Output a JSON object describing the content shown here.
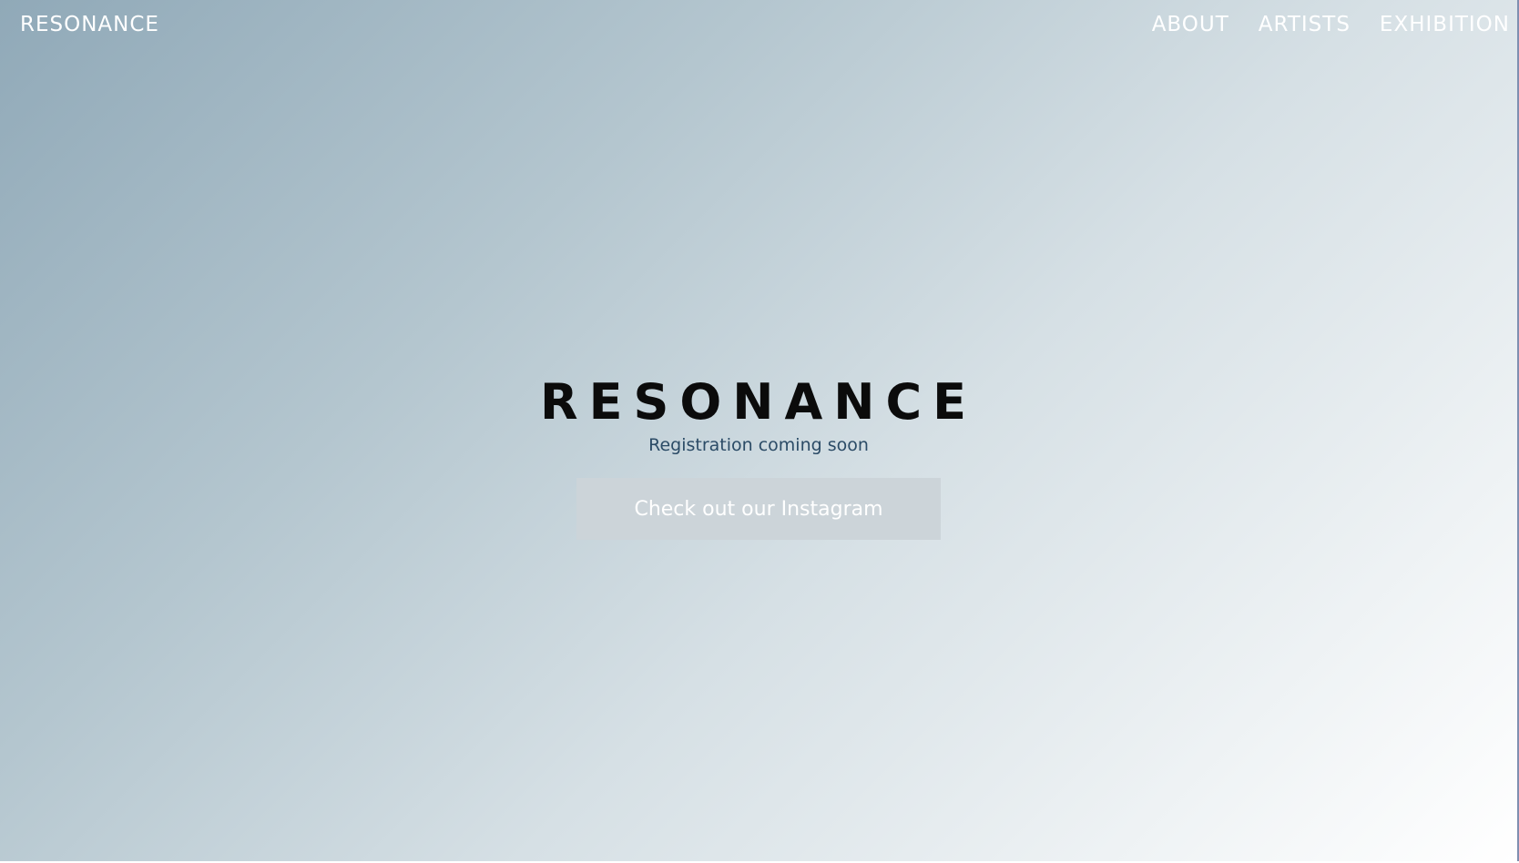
{
  "nav": {
    "logo": "RESONANCE",
    "links": [
      "ABOUT",
      "ARTISTS",
      "EXHIBITION"
    ]
  },
  "hero": {
    "title": "RESONANCE",
    "subtitle": "Registration coming soon",
    "cta_label": "Check out our Instagram"
  },
  "colors": {
    "gradient_start": "#90a9b8",
    "gradient_end": "#ffffff",
    "title_text": "#0b0b0b",
    "subtitle_text": "#2b4b66",
    "button_bg": "#ccd4d9",
    "nav_text": "#ffffff"
  }
}
